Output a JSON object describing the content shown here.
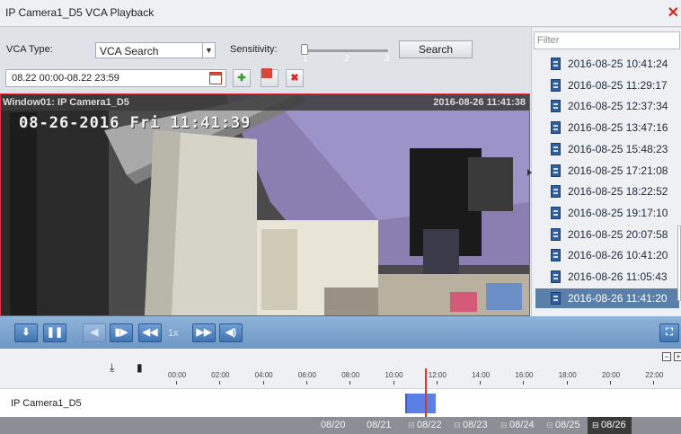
{
  "window": {
    "title": "IP Camera1_D5 VCA Playback"
  },
  "search": {
    "vca_type_label": "VCA Type:",
    "vca_type_value": "VCA Search",
    "sensitivity_label": "Sensitivity:",
    "sensitivity_ticks": [
      "1",
      "2",
      "3"
    ],
    "sensitivity_value": 1,
    "search_label": "Search",
    "time_range": "08.22 00:00-08.22 23:59"
  },
  "video": {
    "window_name": "Window01: IP Camera1_D5",
    "timestamp": "2016-08-26 11:41:38",
    "osd": "08-26-2016 Fri 11:41:39"
  },
  "sidebar": {
    "filter_placeholder": "Filter",
    "records": [
      "2016-08-25 10:41:24",
      "2016-08-25 11:29:17",
      "2016-08-25 12:37:34",
      "2016-08-25 13:47:16",
      "2016-08-25 15:48:23",
      "2016-08-25 17:21:08",
      "2016-08-25 18:22:52",
      "2016-08-25 19:17:10",
      "2016-08-25 20:07:58",
      "2016-08-26 10:41:20",
      "2016-08-26 11:05:43",
      "2016-08-26 11:41:20"
    ],
    "selected_index": 11
  },
  "playback": {
    "speed": "1x"
  },
  "timeline": {
    "hours": [
      "00:00",
      "02:00",
      "04:00",
      "06:00",
      "08:00",
      "10:00",
      "12:00",
      "14:00",
      "16:00",
      "18:00",
      "20:00",
      "22:00"
    ],
    "camera": "IP Camera1_D5",
    "zoom_out": "−",
    "zoom_in": "+"
  },
  "dates": [
    "08/20",
    "08/21",
    "08/22",
    "08/23",
    "08/24",
    "08/25",
    "08/26"
  ],
  "selected_date": "08/26",
  "colors": {
    "accent": "#5a7fa8",
    "segment": "#5b7fe4",
    "cursor": "#d23a2a",
    "close": "#e0201e"
  }
}
